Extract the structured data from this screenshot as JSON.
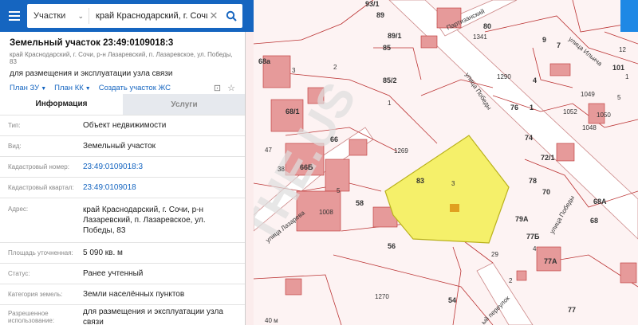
{
  "search": {
    "category": "Участки",
    "query": "край Краснодарский, г. Сочи,"
  },
  "parcel": {
    "title": "Земельный участок 23:49:0109018:3",
    "address_line": "край Краснодарский, г. Сочи, р-н Лазаревский, п. Лазаревское, ул. Победы, 83",
    "purpose": "для размещения и эксплуатации узла связи",
    "links": [
      "План ЗУ",
      "План КК",
      "Создать участок ЖС"
    ]
  },
  "tabs": [
    "Информация",
    "Услуги"
  ],
  "info": [
    {
      "key": "Тип:",
      "value": "Объект недвижимости"
    },
    {
      "key": "Вид:",
      "value": "Земельный участок"
    },
    {
      "key": "Кадастровый номер:",
      "value": "23:49:0109018:3"
    },
    {
      "key": "Кадастровый квартал:",
      "value": "23:49:0109018"
    },
    {
      "key": "Адрес:",
      "value": "край Краснодарский, г. Сочи, р-н Лазаревский, п. Лазаревское, ул. Победы, 83"
    },
    {
      "key": "Площадь уточненная:",
      "value": "5 090 кв. м"
    },
    {
      "key": "Статус:",
      "value": "Ранее учтенный"
    },
    {
      "key": "Категория земель:",
      "value": "Земли населённых пунктов"
    },
    {
      "key": "Разрешенное использование:",
      "value": "для размещения и эксплуатации узла связи"
    }
  ],
  "map": {
    "streets": [
      "улица Победы",
      "улица Лазарева",
      "Партизанский",
      "улица Победы",
      "ый переулок",
      "улица Ильича"
    ],
    "labels": [
      "93/1",
      "89",
      "89/1",
      "85",
      "85/2",
      "1",
      "80",
      "9",
      "7",
      "1341",
      "1290",
      "76",
      "1",
      "4",
      "68а",
      "3",
      "2",
      "68/1",
      "66",
      "1269",
      "83",
      "3",
      "66Б",
      "38",
      "5",
      "42",
      "58",
      "74",
      "72/1",
      "78",
      "70",
      "68А",
      "68",
      "1008",
      "79А",
      "77Б",
      "4",
      "77А",
      "56",
      "2",
      "29",
      "54",
      "1270",
      "77",
      "1049",
      "1050",
      "1052",
      "1048",
      "101",
      "1",
      "5",
      "12",
      "47"
    ],
    "scale": "40 м"
  }
}
